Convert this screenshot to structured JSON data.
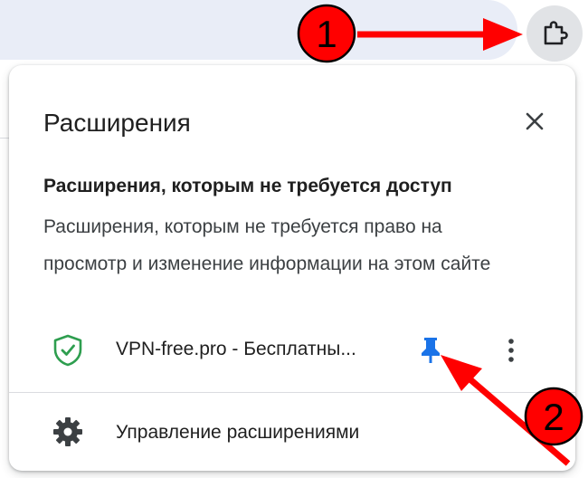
{
  "popup": {
    "title": "Расширения",
    "section_heading": "Расширения, которым не требуется доступ",
    "section_description": "Расширения, которым не требуется право на просмотр и изменение информации на этом сайте",
    "extensions": [
      {
        "name": "VPN-free.pro - Бесплатны...",
        "pinned": true
      }
    ],
    "manage_label": "Управление расширениями"
  },
  "toolbar": {
    "extensions_icon": "puzzle-icon"
  },
  "annotations": {
    "marker_1": "1",
    "marker_2": "2"
  },
  "colors": {
    "pin": "#1a73e8",
    "shield": "#2e9e4f",
    "annotation_red": "#ff0000"
  }
}
